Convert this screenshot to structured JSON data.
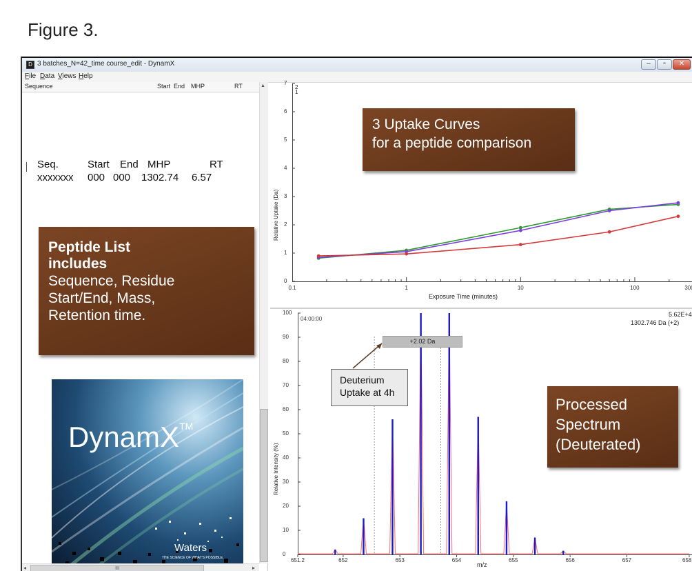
{
  "figure_title": "Figure 3.",
  "window": {
    "icon_letter": "D",
    "title": "3 batches_N=42_time course_edit - DynamX",
    "controls": {
      "minimize": "–",
      "restore": "▫",
      "close": "✕"
    }
  },
  "menu": [
    "File",
    "Data",
    "Views",
    "Help"
  ],
  "peptide_table": {
    "columns": [
      "Sequence",
      "Start",
      "End",
      "MHP",
      "RT"
    ],
    "example_header": {
      "seq": "Seq.",
      "start": "Start",
      "end": "End",
      "mhp": "MHP",
      "rt": "RT"
    },
    "example_row": {
      "seq": "xxxxxxx",
      "start": "000",
      "end": "000",
      "mhp": "1302.74",
      "rt": "6.57"
    },
    "footer_row_text": "...................................",
    "hscroll_thumb_label": "III"
  },
  "annotations": {
    "peptide_list": {
      "title_line1": "Peptide List",
      "title_line2": "includes",
      "body": [
        "Sequence, Residue",
        "Start/End, Mass,",
        "Retention time."
      ]
    },
    "uptake_curves": [
      "3 Uptake Curves",
      "for a peptide comparison"
    ],
    "processed_spectrum": [
      "Processed",
      "Spectrum",
      "(Deuterated)"
    ],
    "deuterium_uptake": [
      "Deuterium",
      "Uptake at 4h"
    ]
  },
  "logo": {
    "brand": "DynamX",
    "trademark": "TM",
    "company": "Waters",
    "tagline": "THE SCIENCE OF WHAT'S POSSIBLE."
  },
  "uptake_chart": {
    "type": "line",
    "ylabel": "Relative Uptake (Da)",
    "xlabel": "Exposure Time (minutes)",
    "x_scale": "log",
    "xlim": [
      0.1,
      300
    ],
    "ylim": [
      0,
      7
    ],
    "y_ticks": [
      "0",
      "1",
      "2",
      "3",
      "4",
      "5",
      "6",
      "7"
    ],
    "x_ticks": [
      "0.1",
      "1",
      "10",
      "100",
      "300"
    ],
    "legend_digits": [
      "2",
      "1"
    ],
    "series": [
      {
        "color": "#2e9a2e",
        "x": [
          0.17,
          1,
          10,
          60,
          240
        ],
        "y": [
          0.82,
          1.1,
          1.9,
          2.55,
          2.72
        ]
      },
      {
        "color": "#7b3fe0",
        "x": [
          0.17,
          1,
          10,
          60,
          240
        ],
        "y": [
          0.85,
          1.05,
          1.8,
          2.5,
          2.78
        ]
      },
      {
        "color": "#d33a3a",
        "x": [
          0.17,
          1,
          10,
          60,
          240
        ],
        "y": [
          0.9,
          0.97,
          1.3,
          1.75,
          2.3
        ]
      }
    ]
  },
  "spectrum_chart": {
    "type": "bar",
    "ylabel": "Relative Intensity (%)",
    "xlabel": "m/z",
    "xlim": [
      651.2,
      658.1
    ],
    "ylim": [
      0,
      100
    ],
    "y_ticks": [
      "0",
      "10",
      "20",
      "30",
      "40",
      "50",
      "60",
      "70",
      "80",
      "90",
      "100"
    ],
    "x_ticks": [
      "651.2",
      "652",
      "653",
      "654",
      "655",
      "656",
      "657",
      "658.1"
    ],
    "intensity_label": "5.62E+4",
    "mass_label": "1302.746 Da (+2)",
    "time_label": "04:00:00",
    "shift_label": "+2.02 Da",
    "peaks_mz": [
      651.86,
      652.36,
      652.87,
      653.37,
      653.87,
      654.38,
      654.88,
      655.38,
      655.88
    ],
    "peaks_intensity": [
      2,
      15,
      56,
      100,
      100,
      57,
      22,
      7,
      1.5
    ],
    "colors": {
      "peak": "#1a1acc",
      "profile": "#ff6a6a"
    }
  }
}
